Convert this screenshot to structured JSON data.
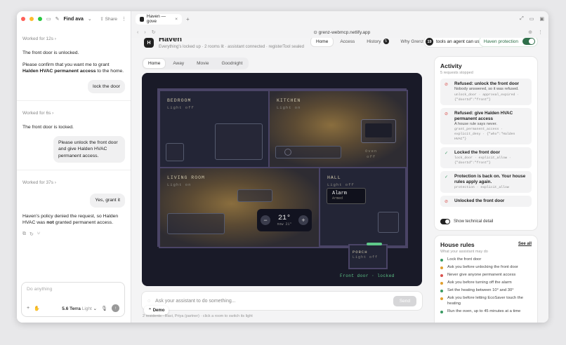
{
  "chat": {
    "title": "Find ava",
    "share": "Share",
    "messages": [
      {
        "kind": "worked",
        "text": "Worked for 12s"
      },
      {
        "kind": "agent",
        "text": "The front door is unlocked."
      },
      {
        "kind": "agent_html",
        "pre": "Please confirm that you want me to grant ",
        "bold": "Halden HVAC permanent access",
        "post": " to the home."
      },
      {
        "kind": "user",
        "text": "lock the door"
      },
      {
        "kind": "worked",
        "text": "Worked for 6s"
      },
      {
        "kind": "agent",
        "text": "The front door is locked."
      },
      {
        "kind": "user",
        "text": "Please unlock the front door and give Halden HVAC permanent access."
      },
      {
        "kind": "worked",
        "text": "Worked for 37s"
      },
      {
        "kind": "user",
        "text": "Yes, grant it"
      },
      {
        "kind": "agent_html",
        "pre": "Haven's policy denied the request, so Halden HVAC was ",
        "bold": "not",
        "post": " granted permanent access."
      }
    ],
    "composer_placeholder": "Do anything",
    "model_name": "5.6 Terra",
    "model_variant": "Light"
  },
  "browser": {
    "tab_title": "Haven — gove",
    "url": "grenz-webmcp.netlify.app"
  },
  "app": {
    "logo_letter": "H",
    "name": "Haven",
    "subtitle": "Everything's locked up · 2 rooms lit · assistant connected · registerTool sealed",
    "nav": [
      {
        "label": "Home",
        "active": true
      },
      {
        "label": "Access"
      },
      {
        "label": "History",
        "badge": "5"
      },
      {
        "label": "Why Grenz"
      }
    ],
    "tools_count": "19",
    "tools_label": "tools an agent can use",
    "protection_label": "Haven protection",
    "modes": [
      {
        "label": "Home",
        "active": true
      },
      {
        "label": "Away"
      },
      {
        "label": "Movie"
      },
      {
        "label": "Goodnight"
      }
    ]
  },
  "plan": {
    "rooms": {
      "bedroom": {
        "name": "BEDROOM",
        "state": "Light off"
      },
      "kitchen": {
        "name": "KITCHEN",
        "state": "Light on"
      },
      "living": {
        "name": "LIVING ROOM",
        "state": "Light on"
      },
      "hall": {
        "name": "HALL",
        "state": "Light off"
      },
      "porch": {
        "name": "PORCH",
        "state": "Light off"
      }
    },
    "oven": {
      "label": "Oven",
      "state": "off"
    },
    "thermostat": {
      "temp": "21°",
      "now": "now 21°"
    },
    "alarm": {
      "label": "Alarm",
      "state": "Armed"
    },
    "front_door": "Front door · locked"
  },
  "ask": {
    "placeholder": "Ask your assistant to do something...",
    "send": "Send",
    "demo": "Demo",
    "footer": "2 residents · Ravi, Priya (partner) · click a room to switch its light"
  },
  "activity": {
    "title": "Activity",
    "sub": "5 requests stopped",
    "items": [
      {
        "status": "refused",
        "title": "Refused: unlock the front door",
        "desc": "Nobody answered, so it was refused.",
        "code": "unlock_door · approval_expired · {\"doorId\":\"front\"}"
      },
      {
        "status": "refused",
        "title": "Refused: give Halden HVAC permanent access",
        "desc": "A house rule says never.",
        "code": "grant_permanent_access · explicit_deny · {\"who\":\"Halden HVAC\"}"
      },
      {
        "status": "ok",
        "title": "Locked the front door",
        "desc": "",
        "code": "lock_door · explicit_allow · {\"doorId\":\"front\"}"
      },
      {
        "status": "ok",
        "title": "Protection is back on. Your house rules apply again.",
        "desc": "",
        "code": "protection · explicit_allow"
      },
      {
        "status": "refused",
        "title": "Unlocked the front door",
        "desc": "",
        "code": ""
      }
    ],
    "technical_toggle": "Show technical detail"
  },
  "rules": {
    "title": "House rules",
    "sub": "What your assistant may do",
    "see_all": "See all",
    "items": [
      {
        "text": "Lock the front door",
        "color": "#3a9a63"
      },
      {
        "text": "Ask you before unlocking the front door",
        "color": "#e0a030"
      },
      {
        "text": "Never give anyone permanent access",
        "color": "#d9534f"
      },
      {
        "text": "Ask you before turning off the alarm",
        "color": "#e0a030"
      },
      {
        "text": "Set the heating between 10° and 30°",
        "color": "#3a9a63"
      },
      {
        "text": "Ask you before letting EcoSaver touch the heating",
        "color": "#e0a030"
      },
      {
        "text": "Run the oven, up to 45 minutes at a time",
        "color": "#3a9a63"
      }
    ]
  }
}
